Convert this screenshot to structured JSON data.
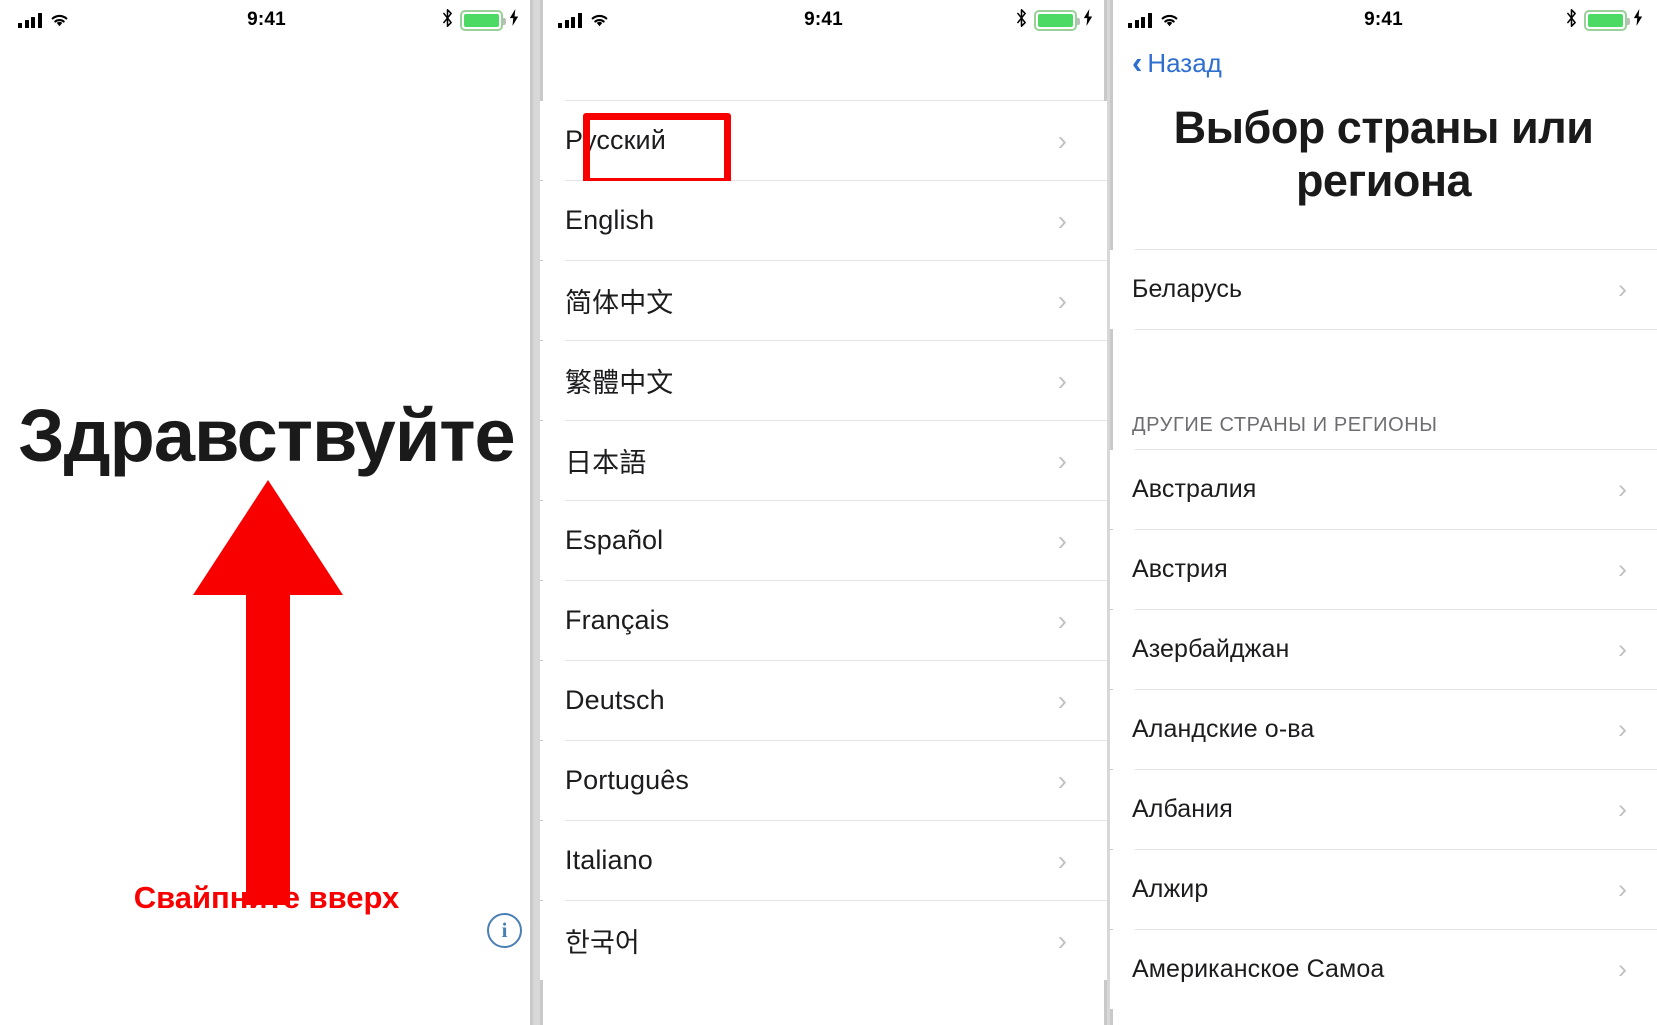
{
  "status_bar": {
    "time": "9:41",
    "signal_icon": "cellular-bars-icon",
    "wifi_icon": "wifi-icon",
    "bluetooth_icon": "bluetooth-icon",
    "battery_icon": "battery-icon",
    "charging_icon": "charging-bolt-icon",
    "battery_color": "#4cd964"
  },
  "panel1": {
    "greeting": "Здравствуйте",
    "swipe_hint": "Свайпните вверх",
    "arrow_icon": "arrow-up-icon",
    "arrow_color": "#f80000",
    "hint_color": "#f80000",
    "info_button_label": "i",
    "info_button_color": "#4a7fb5"
  },
  "panel2": {
    "highlight_color": "#f80000",
    "highlighted_item": "Русский",
    "languages": [
      {
        "label": "Русский",
        "highlighted": true
      },
      {
        "label": "English",
        "highlighted": false
      },
      {
        "label": "简体中文",
        "highlighted": false
      },
      {
        "label": "繁體中文",
        "highlighted": false
      },
      {
        "label": "日本語",
        "highlighted": false
      },
      {
        "label": "Español",
        "highlighted": false
      },
      {
        "label": "Français",
        "highlighted": false
      },
      {
        "label": "Deutsch",
        "highlighted": false
      },
      {
        "label": "Português",
        "highlighted": false
      },
      {
        "label": "Italiano",
        "highlighted": false
      },
      {
        "label": "한국어",
        "highlighted": false
      }
    ],
    "chevron_icon": "chevron-right-icon"
  },
  "panel3": {
    "back_label": "Назад",
    "back_icon": "chevron-left-icon",
    "back_color": "#2f6fd0",
    "title": "Выбор страны или региона",
    "suggested": [
      {
        "label": "Беларусь"
      }
    ],
    "section_header": "ДРУГИЕ СТРАНЫ И РЕГИОНЫ",
    "countries": [
      {
        "label": "Австралия"
      },
      {
        "label": "Австрия"
      },
      {
        "label": "Азербайджан"
      },
      {
        "label": "Аландские о-ва"
      },
      {
        "label": "Албания"
      },
      {
        "label": "Алжир"
      },
      {
        "label": "Американское Самоа"
      }
    ],
    "chevron_icon": "chevron-right-icon"
  }
}
